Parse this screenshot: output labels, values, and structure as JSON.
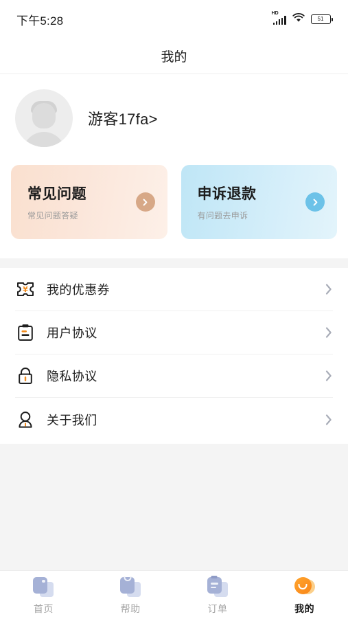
{
  "status_bar": {
    "time": "下午5:28",
    "network_label": "HD",
    "battery_level": "51",
    "icons": [
      "hd-signal-icon",
      "wifi-icon",
      "battery-icon"
    ]
  },
  "header": {
    "title": "我的"
  },
  "profile": {
    "name": "游客17fa>",
    "avatar_alt": "default-avatar"
  },
  "promo_cards": [
    {
      "title": "常见问题",
      "subtitle": "常见问题答疑",
      "accent": "#d7a887",
      "bg_from": "#fae0cf",
      "bg_to": "#fdf0e8"
    },
    {
      "title": "申诉退款",
      "subtitle": "有问题去申诉",
      "accent": "#6cc2e8",
      "bg_from": "#bfe6f6",
      "bg_to": "#e3f4fb"
    }
  ],
  "menu": {
    "items": [
      {
        "label": "我的优惠券",
        "icon": "coupon-icon"
      },
      {
        "label": "用户协议",
        "icon": "clipboard-icon"
      },
      {
        "label": "隐私协议",
        "icon": "lock-icon"
      },
      {
        "label": "关于我们",
        "icon": "person-icon"
      }
    ],
    "chevron": "chevron-right-icon"
  },
  "tabbar": {
    "items": [
      {
        "label": "首页",
        "icon": "home-icon",
        "active": false
      },
      {
        "label": "帮助",
        "icon": "help-bag-icon",
        "active": false
      },
      {
        "label": "订单",
        "icon": "order-document-icon",
        "active": false
      },
      {
        "label": "我的",
        "icon": "profile-smile-icon",
        "active": true
      }
    ]
  },
  "colors": {
    "accent_orange": "#f28c1e",
    "tab_inactive": "#a5b1d6",
    "chevron_gray": "#a9adb8",
    "page_bg": "#f4f4f4"
  }
}
